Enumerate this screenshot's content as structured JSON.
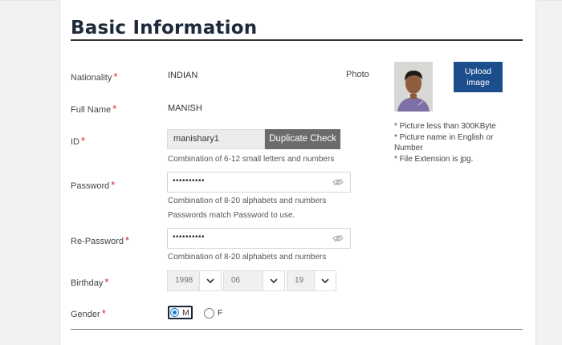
{
  "section": {
    "title": "Basic Information"
  },
  "required_mark": "*",
  "fields": {
    "nationality": {
      "label": "Nationality",
      "value": "INDIAN"
    },
    "fullname": {
      "label": "Full Name",
      "value": "MANISH"
    },
    "id": {
      "label": "ID",
      "value": "manishary1",
      "button": "Duplicate Check",
      "hint": "Combination of 6-12 small letters and numbers"
    },
    "password": {
      "label": "Password",
      "value": "••••••••••",
      "hint1": "Combination of 8-20 alphabets and numbers",
      "hint2": "Passwords match Password to use."
    },
    "repassword": {
      "label": "Re-Password",
      "value": "••••••••••",
      "hint": "Combination of 8-20 alphabets and numbers"
    },
    "birthday": {
      "label": "Birthday",
      "year": "1998",
      "month": "06",
      "day": "19"
    },
    "gender": {
      "label": "Gender",
      "options": [
        "M",
        "F"
      ],
      "selected": "M"
    }
  },
  "photo": {
    "label": "Photo",
    "upload_line1": "Upload",
    "upload_line2": "image",
    "notes": [
      "* Picture less than 300KByte",
      "* Picture name in English or Number",
      "* File Extension is jpg."
    ]
  },
  "colors": {
    "accent": "#1c4e8c",
    "required": "#d9262a",
    "radio": "#1976d2"
  },
  "icons": {
    "password_toggle": "eye-off-icon",
    "select_toggle": "chevron-down-icon"
  }
}
